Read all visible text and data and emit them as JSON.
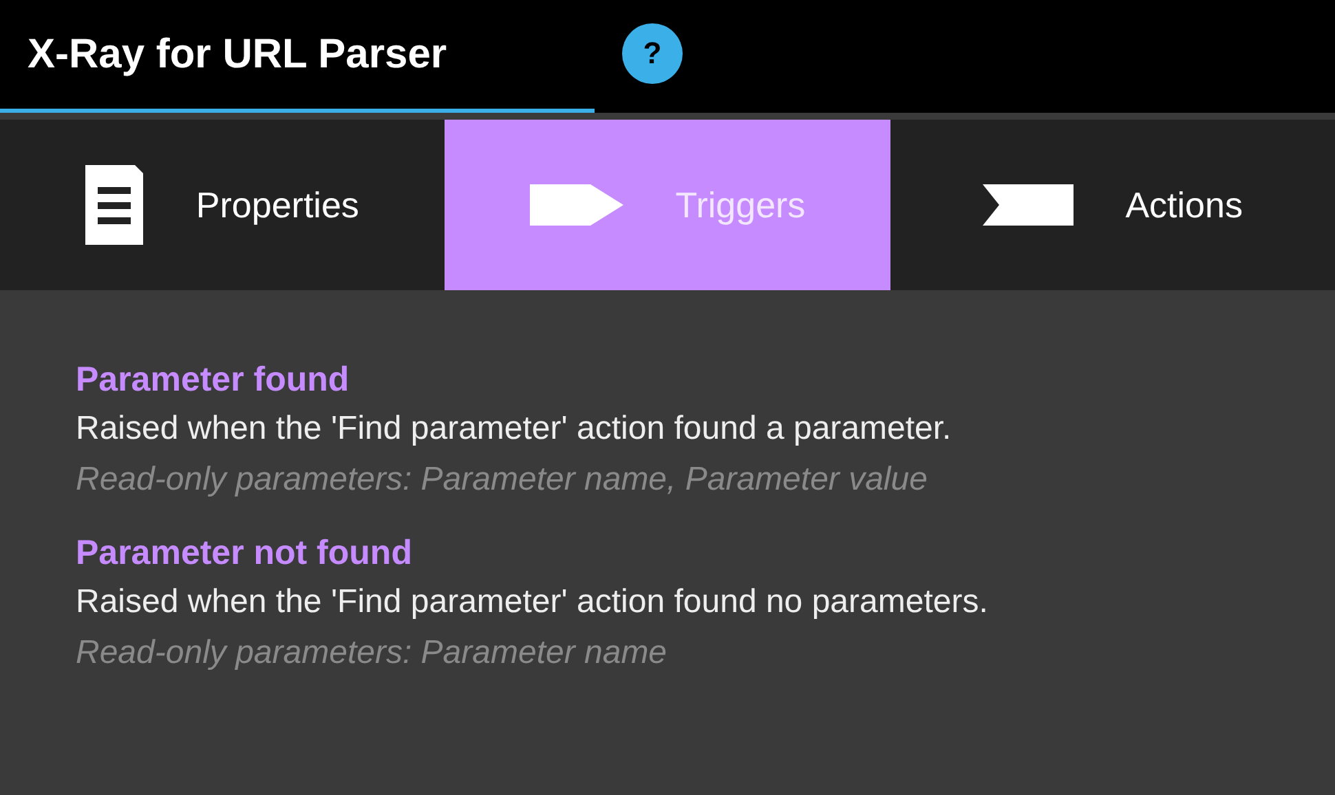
{
  "header": {
    "title": "X-Ray for URL Parser",
    "help": "?"
  },
  "tabs": [
    {
      "label": "Properties",
      "kind": "document",
      "selected": false
    },
    {
      "label": "Triggers",
      "kind": "tag",
      "selected": true
    },
    {
      "label": "Actions",
      "kind": "flag",
      "selected": false
    }
  ],
  "triggers": [
    {
      "name": "Parameter found",
      "description": "Raised when the 'Find parameter' action found a parameter.",
      "parameters": "Read-only parameters: Parameter name, Parameter value"
    },
    {
      "name": "Parameter not found",
      "description": "Raised when the 'Find parameter' action found no parameters.",
      "parameters": "Read-only parameters: Parameter name"
    }
  ]
}
